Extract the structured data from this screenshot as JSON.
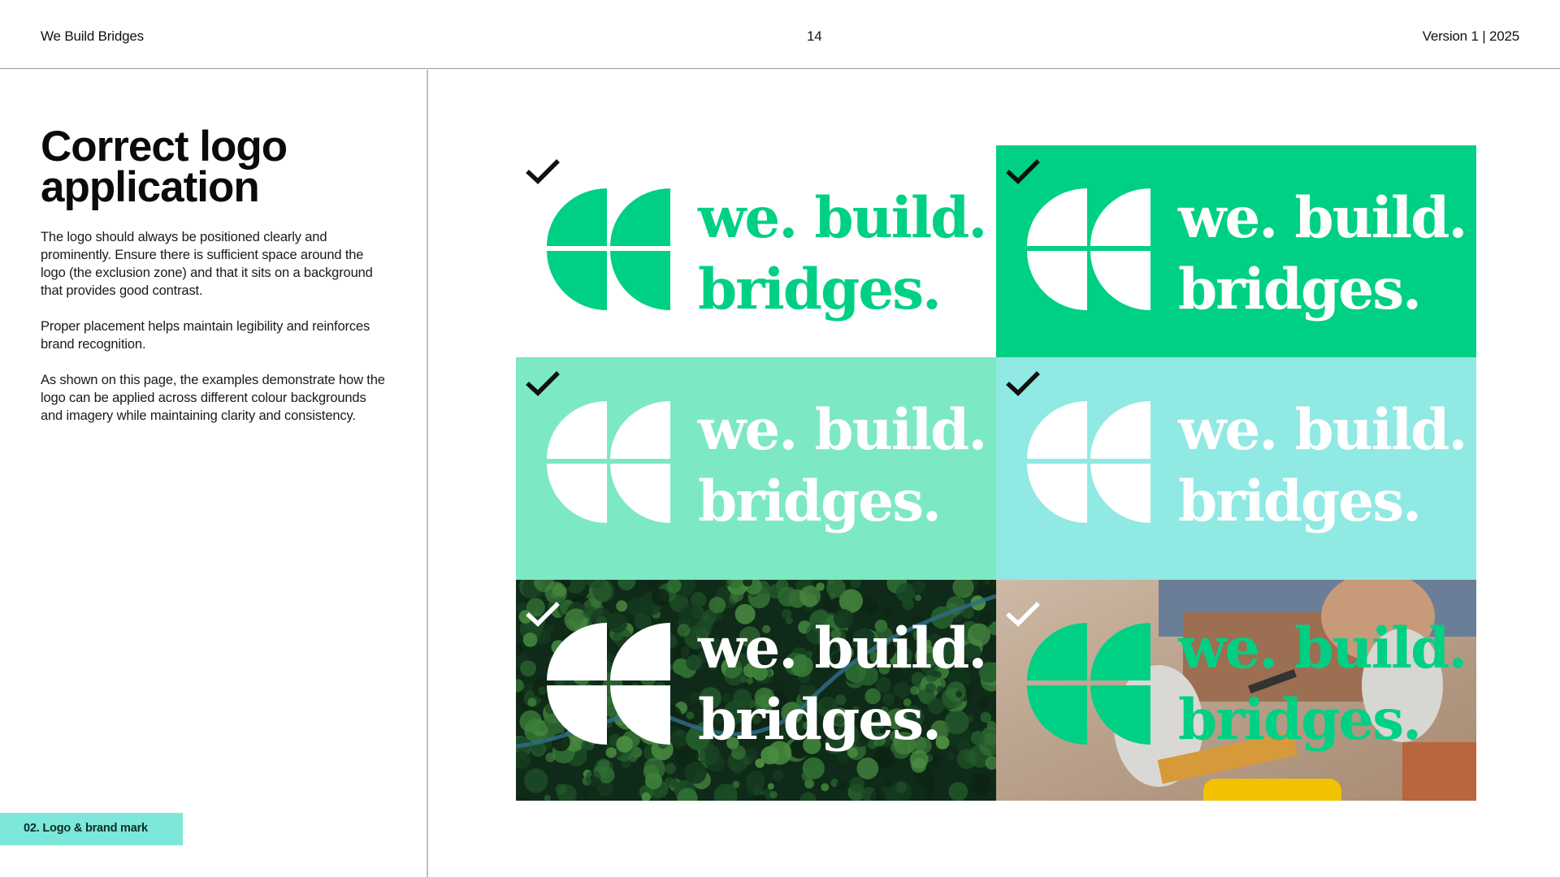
{
  "header": {
    "brand": "We Build Bridges",
    "page_number": "14",
    "version": "Version 1 | 2025"
  },
  "content": {
    "title_line1": "Correct logo",
    "title_line2": "application",
    "paragraph1": "The logo should always be positioned clearly and prominently. Ensure there is sufficient space around the logo (the exclusion zone) and that it sits on a background that provides good contrast.",
    "paragraph2": "Proper placement helps maintain legibility and reinforces brand recognition.",
    "paragraph3": "As shown on this page, the examples demonstrate how the logo can be applied across different colour backgrounds and imagery while maintaining clarity and consistency."
  },
  "section_tag": "02. Logo & brand mark",
  "logo": {
    "wordmark_line1": "we. build.",
    "wordmark_line2": "bridges."
  },
  "examples": [
    {
      "background": "white",
      "bg_color": "#ffffff",
      "logo_color": "#00d084",
      "check_color": "#111111",
      "icon": "checkmark-icon"
    },
    {
      "background": "brand-green",
      "bg_color": "#00d084",
      "logo_color": "#ffffff",
      "check_color": "#111111",
      "icon": "checkmark-icon"
    },
    {
      "background": "mint",
      "bg_color": "#7de8c4",
      "logo_color": "#ffffff",
      "check_color": "#111111",
      "icon": "checkmark-icon"
    },
    {
      "background": "aqua",
      "bg_color": "#90e9e3",
      "logo_color": "#ffffff",
      "check_color": "#111111",
      "icon": "checkmark-icon"
    },
    {
      "background": "forest-aerial-photo",
      "bg_color": "#12301c",
      "logo_color": "#ffffff",
      "check_color": "#ffffff",
      "icon": "checkmark-icon"
    },
    {
      "background": "woodworking-hands-photo",
      "bg_color": "#b89a82",
      "logo_color": "#00d084",
      "check_color": "#ffffff",
      "icon": "checkmark-icon"
    }
  ]
}
